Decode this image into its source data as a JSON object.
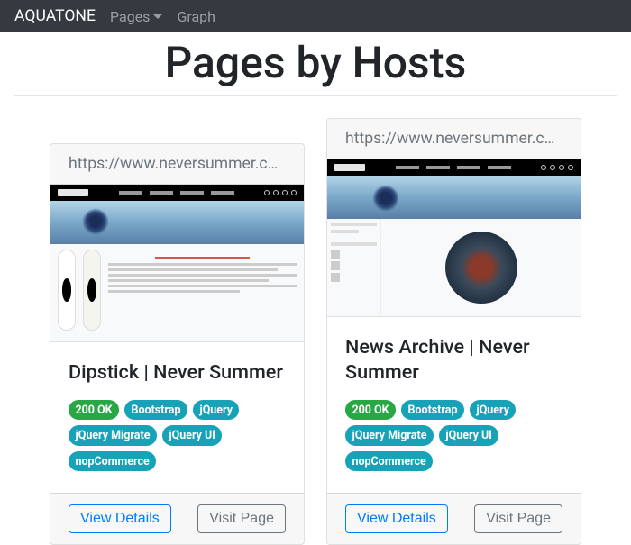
{
  "nav": {
    "brand": "AQUATONE",
    "links": [
      "Pages",
      "Graph"
    ]
  },
  "heading": "Pages by Hosts",
  "cards": [
    {
      "url": "https://www.neversummer.com/di...",
      "title": "Dipstick | Never Summer",
      "status": "200 OK",
      "tech": [
        "Bootstrap",
        "jQuery",
        "jQuery Migrate",
        "jQuery UI",
        "nopCommerce"
      ],
      "view_details": "View Details",
      "visit_page": "Visit Page"
    },
    {
      "url": "https://www.neversummer.com/e...",
      "title": "News Archive | Never Summer",
      "status": "200 OK",
      "tech": [
        "Bootstrap",
        "jQuery",
        "jQuery Migrate",
        "jQuery UI",
        "nopCommerce"
      ],
      "view_details": "View Details",
      "visit_page": "Visit Page"
    }
  ]
}
